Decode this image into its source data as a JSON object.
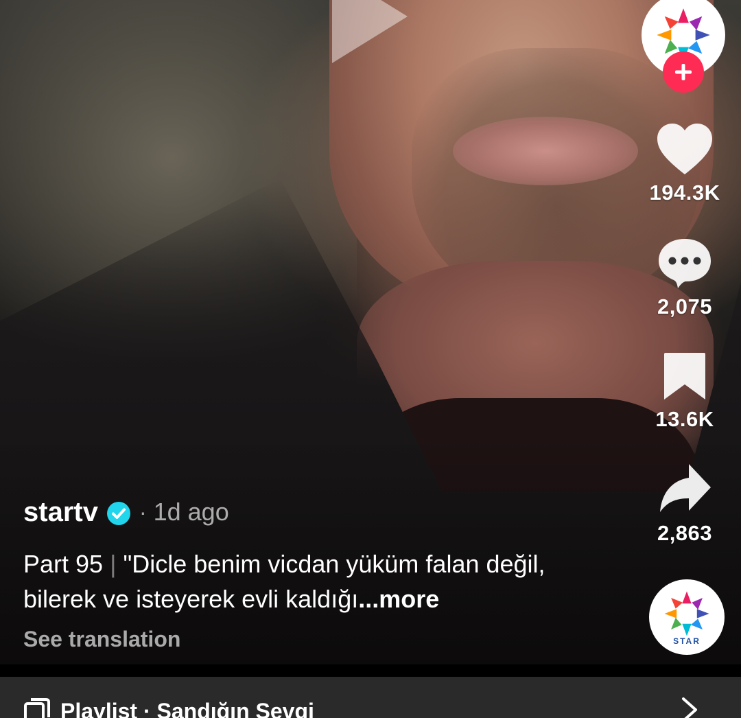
{
  "author": {
    "name": "startv",
    "time": "1d ago",
    "separator": "·"
  },
  "caption": {
    "part": "Part 95",
    "separator": "|",
    "text": "\"Dicle benim vicdan yüküm falan değil, bilerek ve isteyerek evli kaldığı",
    "more": "...more",
    "see_translation": "See translation"
  },
  "actions": {
    "likes": "194.3K",
    "comments": "2,075",
    "saves": "13.6K",
    "shares": "2,863"
  },
  "music_disc": {
    "label": "STAR"
  },
  "playlist": {
    "text": "Playlist · Sandığın Sevgi"
  },
  "icons": {
    "play": "play-icon",
    "follow": "plus-icon",
    "like": "heart-icon",
    "comment": "comment-bubble-icon",
    "save": "bookmark-icon",
    "share": "share-arrow-icon",
    "verified": "verified-badge-icon",
    "playlist": "playlist-icon",
    "chevron": "chevron-right-icon"
  },
  "colors": {
    "follow_badge": "#fe2c55",
    "verified_badge": "#20d5ec",
    "playlist_bar": "#2a2a2a"
  }
}
